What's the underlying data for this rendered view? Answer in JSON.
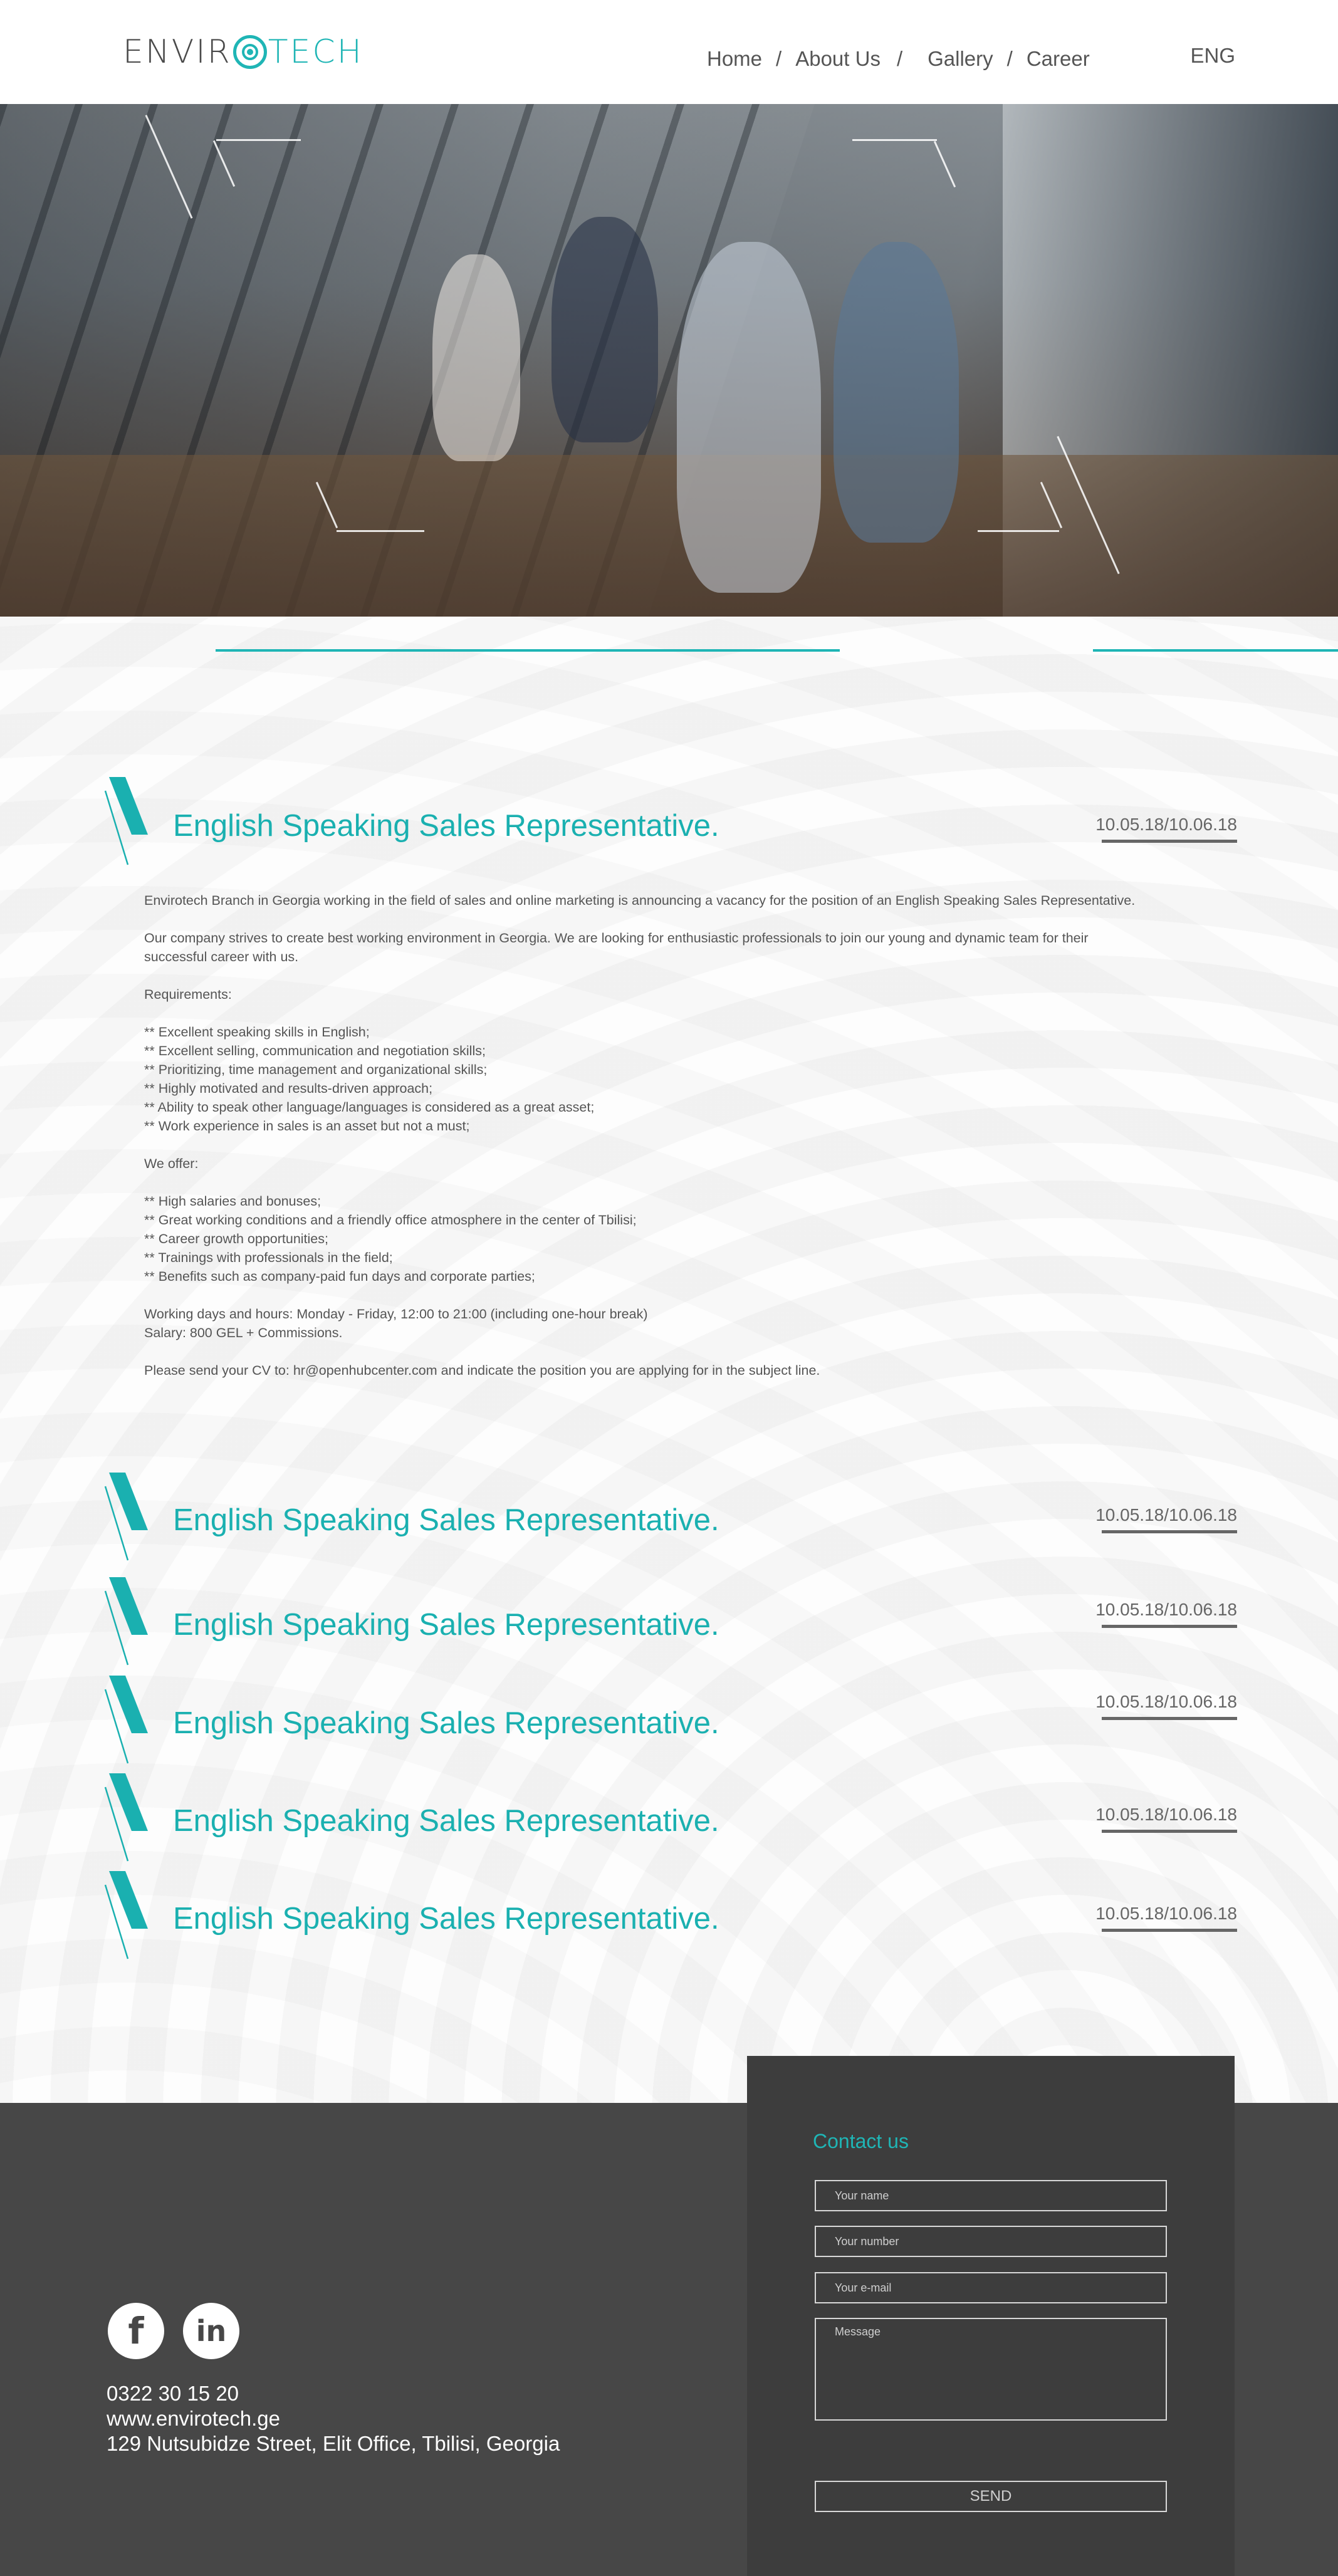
{
  "logo": {
    "text_before": "ENVIR",
    "text_after": "TECH"
  },
  "nav": {
    "items": [
      "Home",
      "About Us",
      "Gallery",
      "Career"
    ],
    "separator": "/"
  },
  "language": "ENG",
  "jobs": [
    {
      "title": "English Speaking Sales Representative.",
      "date": "10.05.18/10.06.18"
    },
    {
      "title": "English Speaking Sales Representative.",
      "date": "10.05.18/10.06.18"
    },
    {
      "title": "English Speaking Sales Representative.",
      "date": "10.05.18/10.06.18"
    },
    {
      "title": "English Speaking Sales Representative.",
      "date": "10.05.18/10.06.18"
    },
    {
      "title": "English Speaking Sales Representative.",
      "date": "10.05.18/10.06.18"
    },
    {
      "title": "English Speaking Sales Representative.",
      "date": "10.05.18/10.06.18"
    }
  ],
  "job_detail": {
    "intro": "Envirotech Branch in Georgia working in the field of sales and online marketing is announcing a vacancy for the position of an English Speaking Sales Representative.",
    "company": "Our company strives to create best working environment in Georgia. We are looking for enthusiastic professionals to join our young and dynamic team for their successful career with us.",
    "requirements_label": "Requirements:",
    "requirements": [
      "** Excellent speaking skills in English;",
      "** Excellent selling, communication and negotiation skills;",
      "** Prioritizing, time management and organizational skills;",
      "** Highly motivated and results-driven approach;",
      "** Ability to speak other language/languages is considered as a great asset;",
      "** Work experience in sales is an asset but not a must;"
    ],
    "offer_label": "We offer:",
    "offers": [
      "** High salaries and bonuses;",
      "** Great working conditions and a friendly office atmosphere in the center of Tbilisi;",
      "** Career growth opportunities;",
      "** Trainings with professionals in the field;",
      "** Benefits such as company-paid fun days and corporate parties;"
    ],
    "hours": "Working days and hours: Monday - Friday, 12:00 to 21:00 (including one-hour break)",
    "salary": "Salary: 800 GEL + Commissions.",
    "apply": "Please send your CV to: hr@openhubcenter.com and indicate the position you are applying for in the subject line."
  },
  "footer": {
    "phone": "0322 30 15 20",
    "website": "www.envirotech.ge",
    "address": "129 Nutsubidze Street, Elit Office, Tbilisi, Georgia",
    "social": {
      "facebook": "f",
      "linkedin": "in"
    }
  },
  "contact": {
    "title": "Contact us",
    "name_placeholder": "Your name",
    "number_placeholder": "Your number",
    "email_placeholder": "Your e-mail",
    "message_placeholder": "Message",
    "send_label": "SEND"
  },
  "colors": {
    "accent": "#1fb5b5",
    "footer_bg": "#474747",
    "contact_bg": "#3d3d3d"
  }
}
